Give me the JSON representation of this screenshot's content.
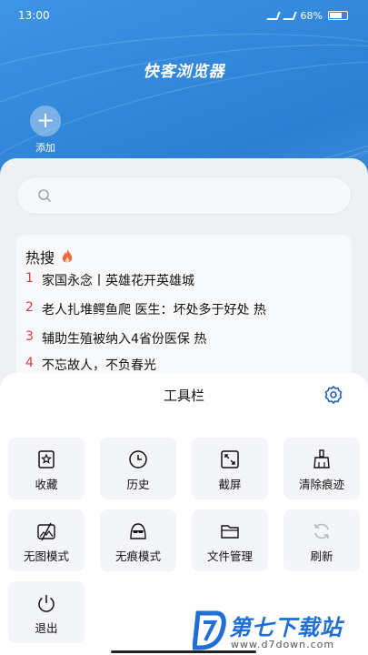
{
  "status": {
    "time": "13:00",
    "battery": "68%"
  },
  "app": {
    "title": "快客浏览器"
  },
  "add": {
    "label": "添加"
  },
  "search": {
    "placeholder": ""
  },
  "hot": {
    "title": "热搜",
    "items": [
      {
        "rank": "1",
        "text": "家国永念丨英雄花开英雄城"
      },
      {
        "rank": "2",
        "text": "老人扎堆鳄鱼爬 医生：坏处多于好处  热"
      },
      {
        "rank": "3",
        "text": "辅助生殖被纳入4省份医保  热"
      },
      {
        "rank": "4",
        "text": "不忘故人，不负春光"
      }
    ]
  },
  "toolbar": {
    "title": "工具栏",
    "tools": [
      {
        "label": "收藏",
        "icon": "star-bookmark-icon"
      },
      {
        "label": "历史",
        "icon": "clock-icon"
      },
      {
        "label": "截屏",
        "icon": "screenshot-icon"
      },
      {
        "label": "清除痕迹",
        "icon": "broom-icon"
      },
      {
        "label": "无图模式",
        "icon": "no-image-icon"
      },
      {
        "label": "无痕模式",
        "icon": "incognito-icon"
      },
      {
        "label": "文件管理",
        "icon": "folder-icon"
      },
      {
        "label": "刷新",
        "icon": "refresh-icon"
      },
      {
        "label": "退出",
        "icon": "power-icon"
      }
    ]
  },
  "watermark": {
    "brand": "第七下载站",
    "url": "www.d7down.com"
  },
  "colors": {
    "accent": "#2b7fd4",
    "hot_rank": "#e23b3b"
  }
}
